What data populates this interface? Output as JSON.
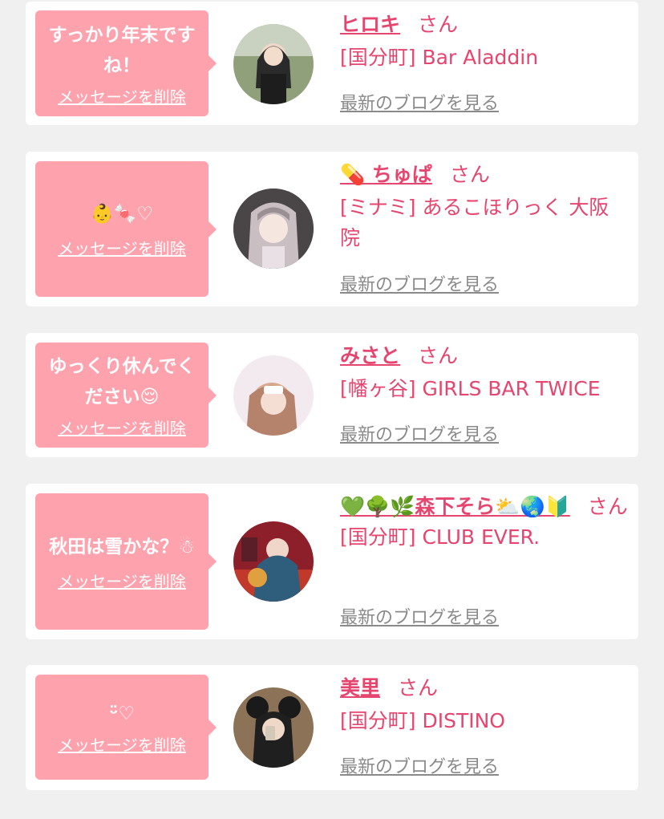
{
  "delete_label": "メッセージを削除",
  "san_label": "さん",
  "blog_label": "最新のブログを見る",
  "items": [
    {
      "message": "すっかり年末です\nね！",
      "name": "ヒロキ",
      "shop": "[国分町] Bar Aladdin"
    },
    {
      "message": "👶🍬♡",
      "name": "💊 ちゅぱ",
      "shop": "[ミナミ] あるこほりっく 大阪\n院"
    },
    {
      "message": "ゆっくり休んでく\nださい😌",
      "name": "みさと",
      "shop": "[幡ヶ谷] GIRLS BAR TWICE"
    },
    {
      "message": "秋田は雪かな？☃",
      "name": "💚🌳🌿森下そら⛅🌏🔰",
      "shop": "[国分町] CLUB EVER."
    },
    {
      "message": "ᵕ̈♡",
      "name": "美里",
      "shop": "[国分町] DISTINO"
    }
  ],
  "colors": {
    "bubble": "#fea2ae",
    "accent": "#e5456e",
    "background": "#f0f0f0"
  }
}
